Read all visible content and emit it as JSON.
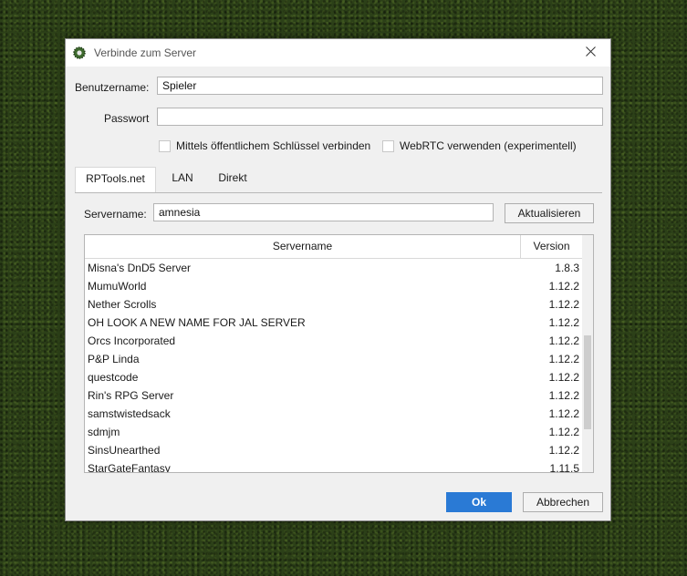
{
  "dialog": {
    "title": "Verbinde zum Server",
    "username_label": "Benutzername:",
    "username_value": "Spieler",
    "password_label": "Passwort",
    "password_value": "",
    "checkbox_public_key": "Mittels öffentlichem Schlüssel verbinden",
    "checkbox_webrtc": "WebRTC verwenden (experimentell)"
  },
  "tabs": [
    {
      "label": "RPTools.net",
      "active": true
    },
    {
      "label": "LAN",
      "active": false
    },
    {
      "label": "Direkt",
      "active": false
    }
  ],
  "search": {
    "label": "Servername:",
    "value": "amnesia",
    "refresh_label": "Aktualisieren"
  },
  "table": {
    "col_name": "Servername",
    "col_version": "Version",
    "rows": [
      {
        "name": "Misna's DnD5 Server",
        "version": "1.8.3"
      },
      {
        "name": "MumuWorld",
        "version": "1.12.2"
      },
      {
        "name": "Nether Scrolls",
        "version": "1.12.2"
      },
      {
        "name": "OH LOOK A NEW NAME FOR JAL SERVER",
        "version": "1.12.2"
      },
      {
        "name": "Orcs Incorporated",
        "version": "1.12.2"
      },
      {
        "name": "P&P Linda",
        "version": "1.12.2"
      },
      {
        "name": "questcode",
        "version": "1.12.2"
      },
      {
        "name": "Rin's RPG Server",
        "version": "1.12.2"
      },
      {
        "name": "samstwistedsack",
        "version": "1.12.2"
      },
      {
        "name": "sdmjm",
        "version": "1.12.2"
      },
      {
        "name": "SinsUnearthed",
        "version": "1.12.2"
      },
      {
        "name": "StarGateFantasy",
        "version": "1.11.5"
      }
    ]
  },
  "footer": {
    "ok_label": "Ok",
    "cancel_label": "Abbrechen"
  },
  "colors": {
    "accent": "#2a7ad5",
    "background": "#2c4018"
  },
  "icons": {
    "app": "maptool-gear-icon",
    "close": "close-icon"
  }
}
